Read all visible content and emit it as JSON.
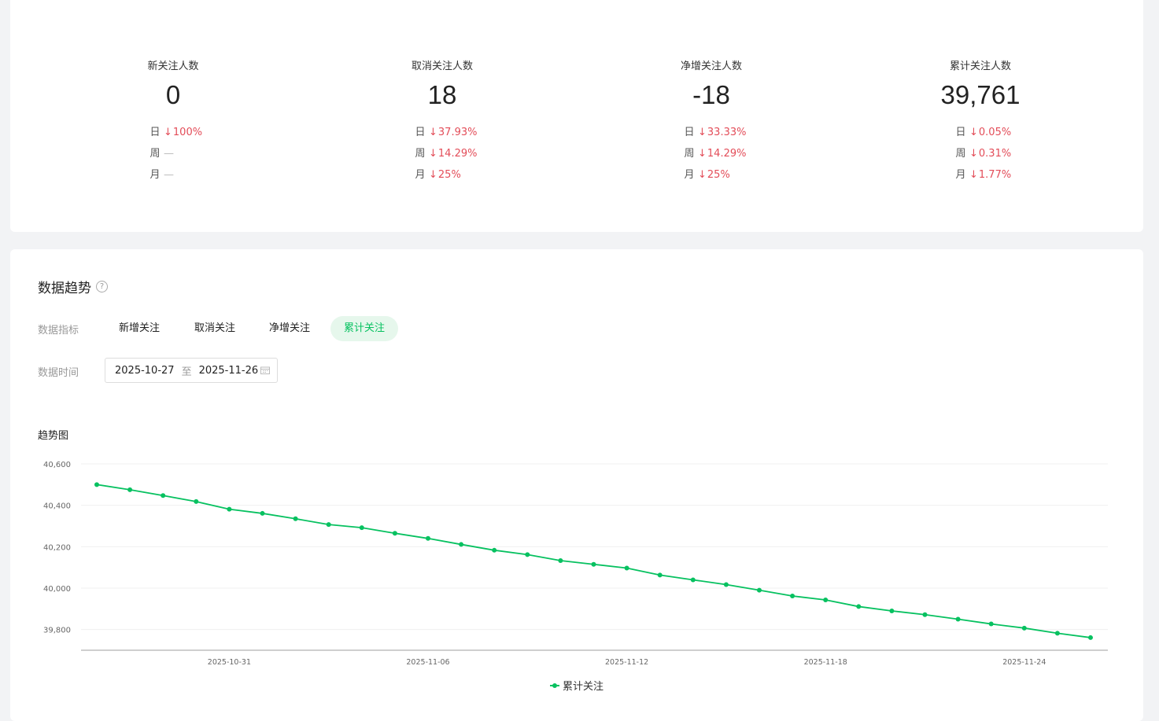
{
  "stats": [
    {
      "title": "新关注人数",
      "value": "0",
      "rows": [
        {
          "period": "日",
          "change": "100%",
          "dir": "down"
        },
        {
          "period": "周",
          "change": "—",
          "dir": "none"
        },
        {
          "period": "月",
          "change": "—",
          "dir": "none"
        }
      ]
    },
    {
      "title": "取消关注人数",
      "value": "18",
      "rows": [
        {
          "period": "日",
          "change": "37.93%",
          "dir": "down"
        },
        {
          "period": "周",
          "change": "14.29%",
          "dir": "down"
        },
        {
          "period": "月",
          "change": "25%",
          "dir": "down"
        }
      ]
    },
    {
      "title": "净增关注人数",
      "value": "-18",
      "rows": [
        {
          "period": "日",
          "change": "33.33%",
          "dir": "down"
        },
        {
          "period": "周",
          "change": "14.29%",
          "dir": "down"
        },
        {
          "period": "月",
          "change": "25%",
          "dir": "down"
        }
      ]
    },
    {
      "title": "累计关注人数",
      "value": "39,761",
      "rows": [
        {
          "period": "日",
          "change": "0.05%",
          "dir": "down"
        },
        {
          "period": "周",
          "change": "0.31%",
          "dir": "down"
        },
        {
          "period": "月",
          "change": "1.77%",
          "dir": "down"
        }
      ]
    }
  ],
  "trend": {
    "title": "数据趋势",
    "metric_label": "数据指标",
    "metrics": [
      "新增关注",
      "取消关注",
      "净增关注",
      "累计关注"
    ],
    "active_metric": "累计关注",
    "time_label": "数据时间",
    "date_start": "2025-10-27",
    "date_sep": "至",
    "date_end": "2025-11-26",
    "chart_title": "趋势图"
  },
  "colors": {
    "accent": "#07c160",
    "negative": "#e34d59"
  },
  "chart_data": {
    "type": "line",
    "title": "",
    "xlabel": "",
    "ylabel": "",
    "x": [
      "2025-10-27",
      "2025-10-28",
      "2025-10-29",
      "2025-10-30",
      "2025-10-31",
      "2025-11-01",
      "2025-11-02",
      "2025-11-03",
      "2025-11-04",
      "2025-11-05",
      "2025-11-06",
      "2025-11-07",
      "2025-11-08",
      "2025-11-09",
      "2025-11-10",
      "2025-11-11",
      "2025-11-12",
      "2025-11-13",
      "2025-11-14",
      "2025-11-15",
      "2025-11-16",
      "2025-11-17",
      "2025-11-18",
      "2025-11-19",
      "2025-11-20",
      "2025-11-21",
      "2025-11-22",
      "2025-11-23",
      "2025-11-24",
      "2025-11-25",
      "2025-11-26"
    ],
    "series": [
      {
        "name": "累计关注",
        "values": [
          40500,
          40475,
          40447,
          40418,
          40381,
          40361,
          40335,
          40307,
          40292,
          40265,
          40240,
          40211,
          40183,
          40162,
          40133,
          40115,
          40097,
          40063,
          40040,
          40017,
          39990,
          39962,
          39943,
          39911,
          39890,
          39872,
          39850,
          39827,
          39807,
          39782,
          39761
        ]
      }
    ],
    "ylim": [
      39700,
      40600
    ],
    "yticks": [
      39800,
      40000,
      40200,
      40400,
      40600
    ],
    "ytick_labels": [
      "39,800",
      "40,000",
      "40,200",
      "40,400",
      "40,600"
    ],
    "xtick_labels": [
      "2025-10-31",
      "2025-11-06",
      "2025-11-12",
      "2025-11-18",
      "2025-11-24"
    ],
    "grid": true,
    "legend": "bottom-center"
  }
}
